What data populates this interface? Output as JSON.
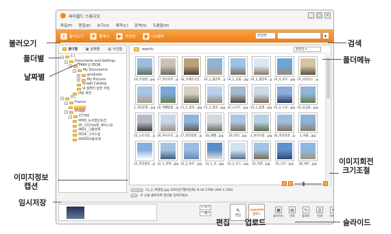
{
  "window": {
    "title": "싸이월드 스튜디오",
    "buttons": [
      "_",
      "□",
      "×"
    ]
  },
  "menu": [
    "파일(F)",
    "편집(E)",
    "보기(V)",
    "제작(C)",
    "검색(S)",
    "도움말(H)"
  ],
  "toolbar": {
    "items": [
      {
        "label": "불러오기",
        "icon": "import-icon",
        "glyph": "↓"
      },
      {
        "label": "플래시",
        "icon": "flash-icon",
        "glyph": "★"
      },
      {
        "label": "동영상",
        "icon": "video-icon",
        "glyph": "▶"
      },
      {
        "label": "CD제작",
        "icon": "cd-icon",
        "glyph": "◉"
      }
    ],
    "search_select": "파일명",
    "search_go": "▸"
  },
  "left_panel": {
    "tabs": [
      "폴더별",
      "날짜별",
      "사진첩"
    ],
    "tree": [
      {
        "depth": 0,
        "toggle": "−",
        "label": "C:\\"
      },
      {
        "depth": 1,
        "toggle": "−",
        "label": "Documents and Settings"
      },
      {
        "depth": 2,
        "toggle": "−",
        "label": "PARK JI YEON"
      },
      {
        "depth": 3,
        "toggle": "−",
        "label": "My Documents"
      },
      {
        "depth": 4,
        "toggle": "+",
        "label": "graduate"
      },
      {
        "depth": 4,
        "toggle": "+",
        "label": "My Pictures"
      },
      {
        "depth": 4,
        "toggle": "",
        "label": "Snagit Catalog"
      },
      {
        "depth": 4,
        "toggle": "",
        "label": "내 컴퓨터 받은 파일"
      },
      {
        "depth": 3,
        "toggle": "",
        "label": "바탕 화면"
      },
      {
        "depth": 0,
        "toggle": "−",
        "label": "D:\\"
      },
      {
        "depth": 1,
        "toggle": "−",
        "label": "France"
      },
      {
        "depth": 2,
        "toggle": "",
        "label": "wanfu",
        "selected": true
      },
      {
        "depth": 1,
        "toggle": "−",
        "label": "Image"
      },
      {
        "depth": 2,
        "toggle": "−",
        "label": "CY700"
      },
      {
        "depth": 3,
        "toggle": "",
        "label": "0000_도서엽인오전"
      },
      {
        "depth": 3,
        "toggle": "",
        "label": "05_이미지보존_루이나오"
      },
      {
        "depth": 3,
        "toggle": "",
        "label": "0601_그룹연재"
      },
      {
        "depth": 3,
        "toggle": "",
        "label": "0029_그리스일"
      },
      {
        "depth": 3,
        "toggle": "",
        "label": "20050카풀모제"
      }
    ]
  },
  "main": {
    "folder_name": "wanfu",
    "sort_select": "촬영일 ▾",
    "thumbnails": [
      {
        "caption": "16_트벗센...jpg",
        "colors": [
          "#9cbce0",
          "#5f6f5a"
        ]
      },
      {
        "caption": "17_파리의주...jpg",
        "colors": [
          "#c9c2b8",
          "#6c6559"
        ]
      },
      {
        "caption": "18_오페라극장...jpg",
        "colors": [
          "#b7a27a",
          "#4d3e2b"
        ]
      },
      {
        "caption": "19_1_물란루...jpg",
        "colors": [
          "#8fb2d6",
          "#a99d86"
        ]
      },
      {
        "caption": "19_2_동물...jpg",
        "colors": [
          "#9bc3e8",
          "#7b6f5f"
        ]
      },
      {
        "caption": "19_3_물란루...jpg",
        "colors": [
          "#dce7f0",
          "#8d7a66"
        ]
      },
      {
        "caption": "19_4_루즈...jpg",
        "colors": [
          "#6fa3d7",
          "#9a8a74"
        ]
      },
      {
        "caption": "19_사진리스...jpg",
        "colors": [
          "#d5c3a2",
          "#5e5142"
        ]
      },
      {
        "caption": "1_개선문앞...jpg",
        "colors": [
          "#a7c5e8",
          "#aa9c84"
        ]
      },
      {
        "caption": "20_에펠탑앞...jpg",
        "colors": [
          "#7ca6d8",
          "#6b7d52"
        ]
      },
      {
        "caption": "21_1_방리...jpg",
        "colors": [
          "#d8d0c4",
          "#5a5248"
        ]
      },
      {
        "caption": "21_2_방리...jpg",
        "colors": [
          "#b9d1ea",
          "#8f8778"
        ]
      },
      {
        "caption": "22_노트르...jpg",
        "colors": [
          "#a4b9cf",
          "#4f4a42"
        ]
      },
      {
        "caption": "23_1_풍경...jpg",
        "colors": [
          "#cbd9e8",
          "#7d6a52"
        ]
      },
      {
        "caption": "23_2_스보...jpg",
        "colors": [
          "#88aedd",
          "#2e3b56"
        ]
      },
      {
        "caption": "24_동상들...jpg",
        "colors": [
          "#93b4d9",
          "#6a7a4c"
        ]
      },
      {
        "caption": "25_노트르담...jpg",
        "colors": [
          "#b5bcc4",
          "#3d3b38"
        ]
      },
      {
        "caption": "26_루브르지...jpg",
        "colors": [
          "#c6d7ea",
          "#9a8f7d"
        ]
      },
      {
        "caption": "27_파리풍경...jpg",
        "colors": [
          "#8db6df",
          "#5c5a4b"
        ]
      },
      {
        "caption": "28_에펠...jpg",
        "colors": [
          "#d0d8e0",
          "#6c6f66"
        ]
      },
      {
        "caption": "29_파리...jpg",
        "colors": [
          "#aac6e4",
          "#7a6c58"
        ]
      },
      {
        "caption": "2_바나나풍...jpg",
        "colors": [
          "#b7d0e6",
          "#5d6c47"
        ]
      },
      {
        "caption": "30_파리야경...jpg",
        "colors": [
          "#9fbde0",
          "#7f7462"
        ]
      },
      {
        "caption": "3_서울...jpg",
        "colors": [
          "#8eb2d8",
          "#8b8170"
        ]
      },
      {
        "caption": "31_파리센강...jpg",
        "colors": [
          "#86aee0",
          "#ffffff"
        ]
      },
      {
        "caption": "32_1_파파...jpg",
        "colors": [
          "#a4c2e2",
          "#435a7e"
        ]
      },
      {
        "caption": "32_2_보트...jpg",
        "colors": [
          "#99bde6",
          "#6f88a9"
        ]
      },
      {
        "caption": "33_1_모...jpg",
        "colors": [
          "#5a8cc9",
          "#e6e1d4"
        ]
      },
      {
        "caption": "33_2_모스...jpg",
        "colors": [
          "#d2e3f2",
          "#586f8d"
        ]
      },
      {
        "caption": "35_여관...jpg",
        "colors": [
          "#a3c3e5",
          "#7a6a58"
        ]
      },
      {
        "caption": "35_오르...jpg",
        "colors": [
          "#5f90d0",
          "#2f4870"
        ]
      },
      {
        "caption": "38_세우...jpg",
        "colors": [
          "#8fb7e3",
          "#9d9583"
        ]
      }
    ]
  },
  "info": {
    "file_label": "파일정보",
    "file_value": "12_2_여행길.jpg    2005년7월5일(화) 8:30    57KB (400 X 300)",
    "caption_label": "캡션",
    "caption_value": "이 곳을 클릭하여 캡션을 입력하세요."
  },
  "bottom": {
    "tray_add": "+ 보기",
    "tray_remove": "− 빼기",
    "edit_label": "편집",
    "upload_label": "업로드",
    "upload_glyph": "cyworld",
    "icons": [
      {
        "label": "슬라이드",
        "icon": "slideshow-icon",
        "glyph": "▦"
      },
      {
        "label": "인화",
        "icon": "print-photo-icon",
        "glyph": "▤"
      },
      {
        "label": "돌려쓰",
        "icon": "rotate-icon",
        "glyph": "↻"
      },
      {
        "label": "인쇄",
        "icon": "printer-icon",
        "glyph": "⎙"
      },
      {
        "label": "이메일",
        "icon": "email-icon",
        "glyph": "✉"
      }
    ]
  },
  "callouts": {
    "import": "불러오기",
    "search": "검색",
    "by_folder": "폴더별",
    "folder_menu": "폴더메뉴",
    "by_date": "날짜별",
    "rotate_resize": "이미지회전\n크기조절",
    "info_caption": "이미지정보\n캡션",
    "temp_save": "임시저장",
    "edit": "편집",
    "upload": "업로드",
    "slide": "슬라이드"
  }
}
